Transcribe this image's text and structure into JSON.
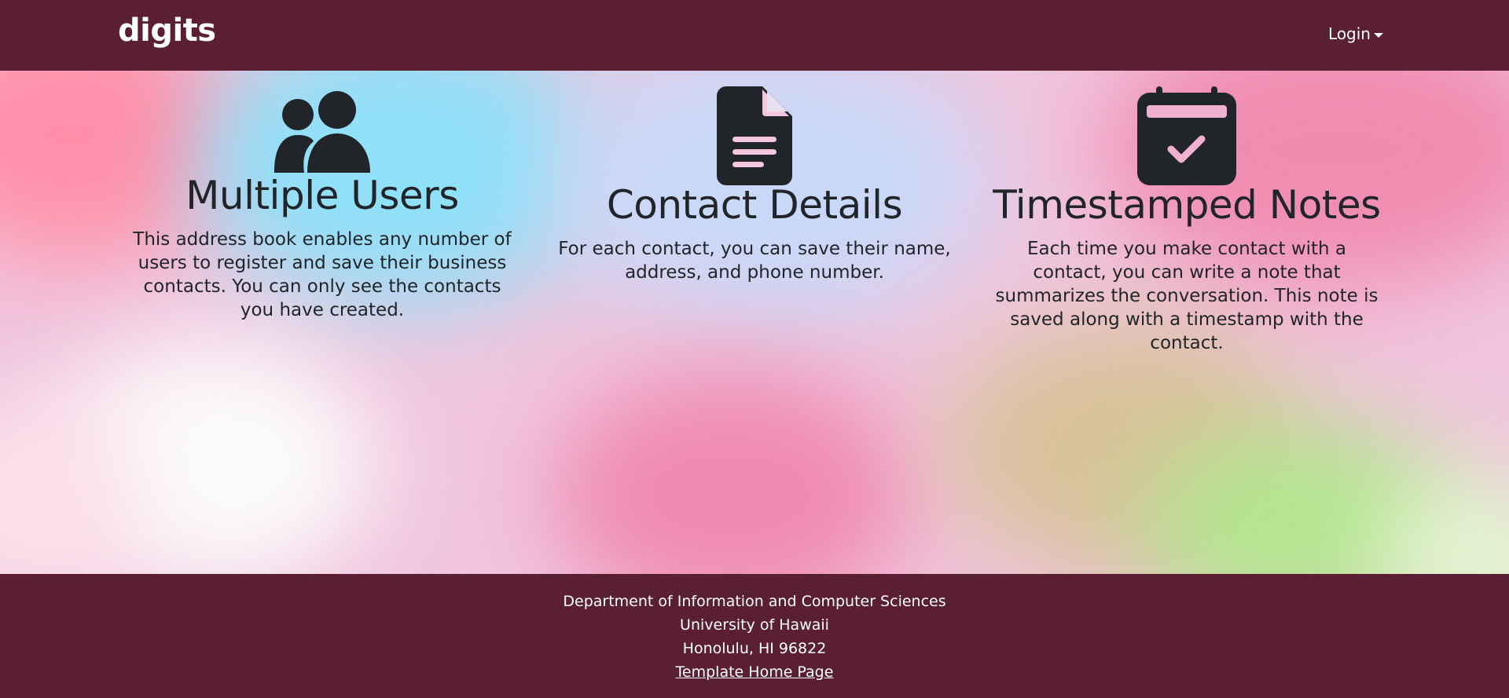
{
  "navbar": {
    "brand": "digits",
    "login_label": "Login"
  },
  "features": [
    {
      "icon": "users-icon",
      "title": "Multiple Users",
      "text": "This address book enables any number of users to register and save their business contacts. You can only see the contacts you have created."
    },
    {
      "icon": "file-text-icon",
      "title": "Contact Details",
      "text": "For each contact, you can save their name, address, and phone number."
    },
    {
      "icon": "calendar-check-icon",
      "title": "Timestamped Notes",
      "text": "Each time you make contact with a contact, you can write a note that summarizes the conversation. This note is saved along with a timestamp with the contact."
    }
  ],
  "footer": {
    "line1": "Department of Information and Computer Sciences",
    "line2": "University of Hawaii",
    "line3": "Honolulu, HI 96822",
    "link": "Template Home Page"
  },
  "colors": {
    "primary": "#5a1f33",
    "text": "#212529",
    "icon": "#212529"
  }
}
